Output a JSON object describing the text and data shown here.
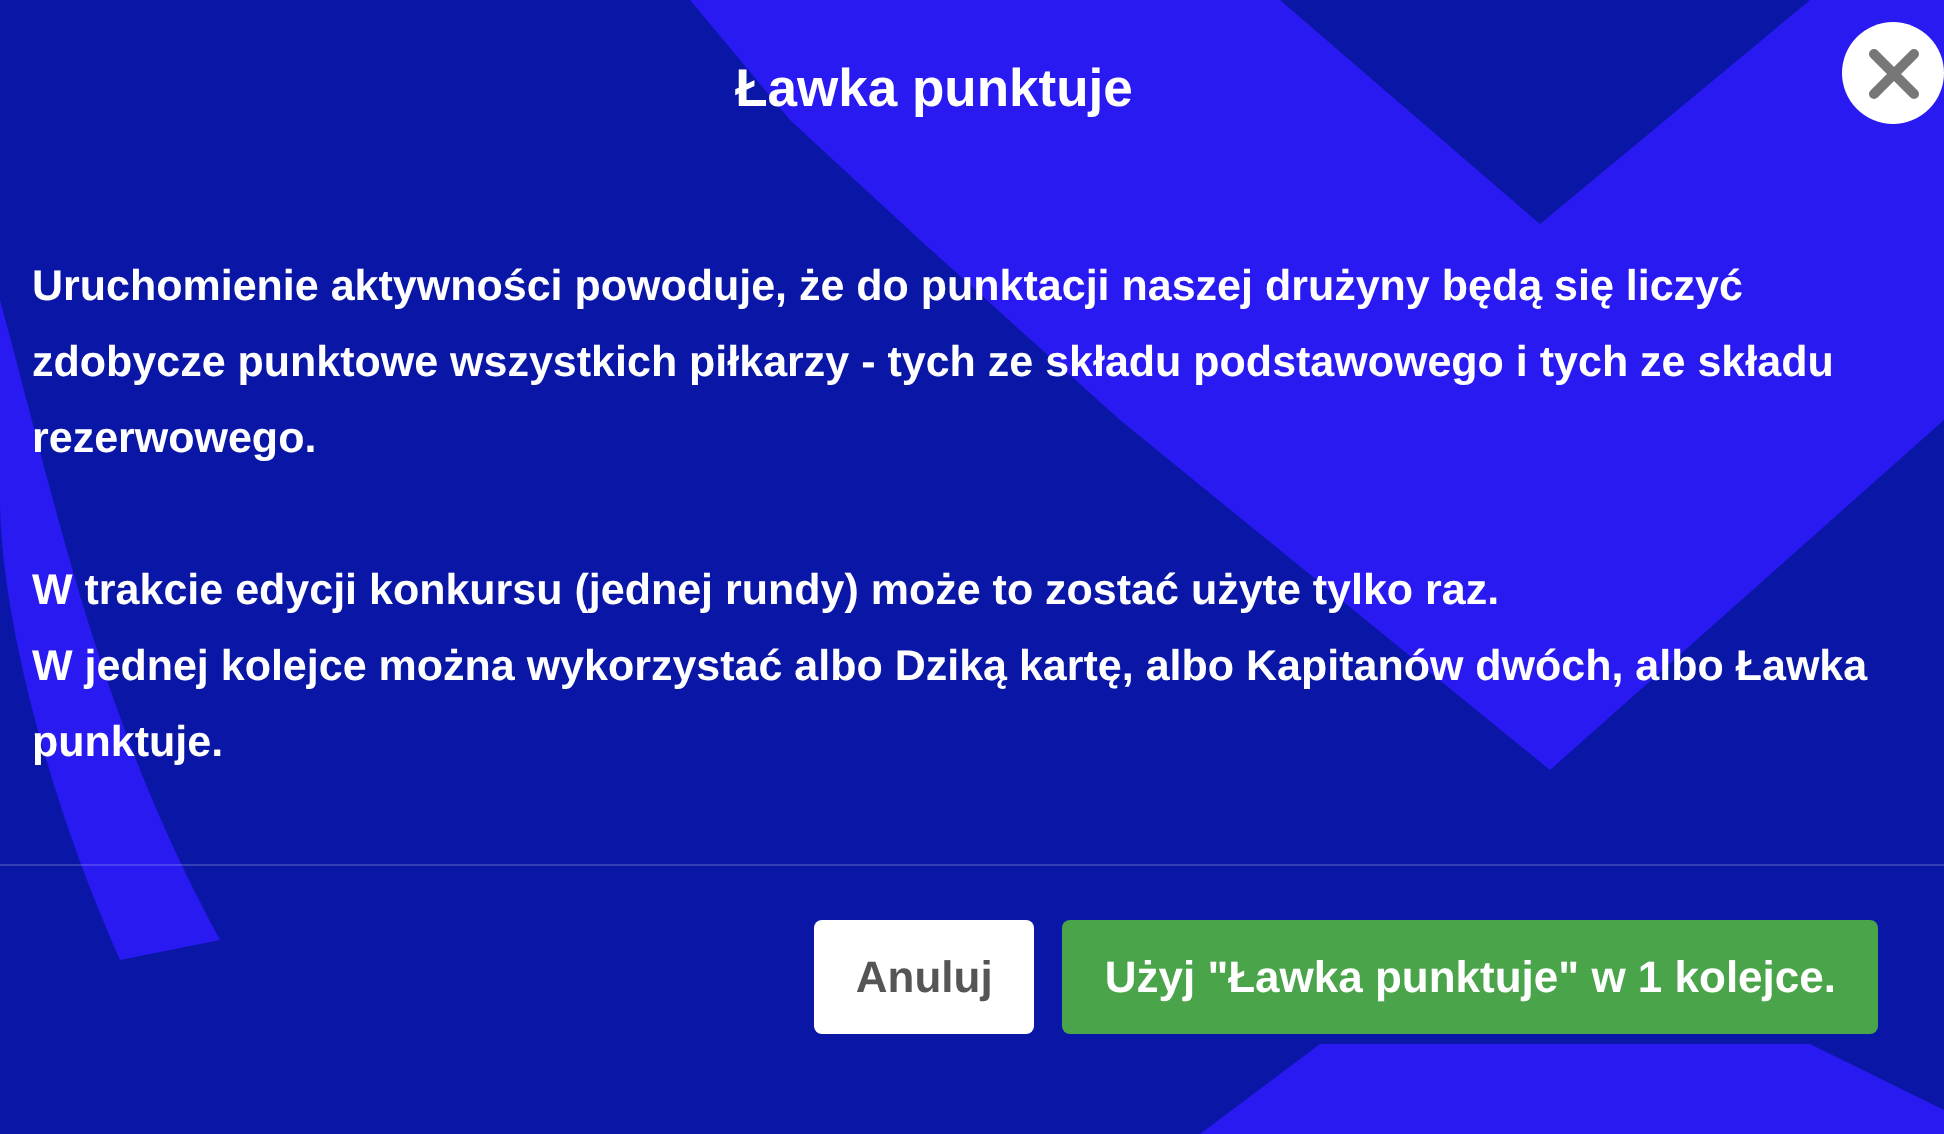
{
  "dialog": {
    "title": "Ławka punktuje",
    "paragraphs": [
      [
        "Uruchomienie aktywności powoduje, że do punktacji naszej drużyny będą się liczyć zdobycze punktowe wszystkich piłkarzy - tych ze składu podstawowego i tych ze składu rezerwowego."
      ],
      [
        "W trakcie edycji konkursu (jednej rundy) może to zostać użyte tylko raz.",
        "W jednej kolejce można wykorzystać albo Dziką kartę, albo Kapitanów dwóch, albo Ławka punktuje."
      ]
    ],
    "buttons": [
      {
        "label": "Anuluj",
        "kind": "secondary"
      },
      {
        "label": "Użyj \"Ławka punktuje\" w 1 kolejce.",
        "kind": "primary"
      }
    ]
  }
}
